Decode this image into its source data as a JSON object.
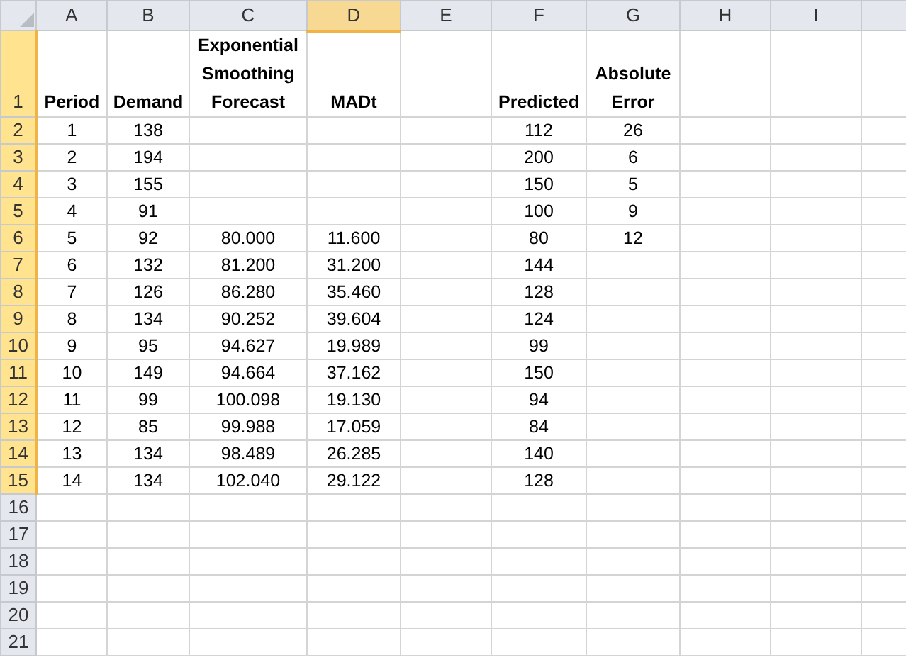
{
  "columns": [
    {
      "letter": "A",
      "selected": false
    },
    {
      "letter": "B",
      "selected": false
    },
    {
      "letter": "C",
      "selected": false
    },
    {
      "letter": "D",
      "selected": true
    },
    {
      "letter": "E",
      "selected": false
    },
    {
      "letter": "F",
      "selected": false
    },
    {
      "letter": "G",
      "selected": false
    },
    {
      "letter": "H",
      "selected": false
    },
    {
      "letter": "I",
      "selected": false
    }
  ],
  "rows": [
    {
      "number": "1",
      "selected": true,
      "kind": "header",
      "cells": [
        "Period",
        "Demand",
        "Exponential Smoothing Forecast",
        "MADt",
        null,
        "Predicted",
        "Absolute Error"
      ]
    },
    {
      "number": "2",
      "selected": true,
      "kind": "data",
      "cells": [
        "1",
        "138",
        null,
        null,
        null,
        "112",
        "26"
      ]
    },
    {
      "number": "3",
      "selected": true,
      "kind": "data",
      "cells": [
        "2",
        "194",
        null,
        null,
        null,
        "200",
        "6"
      ]
    },
    {
      "number": "4",
      "selected": true,
      "kind": "data",
      "cells": [
        "3",
        "155",
        null,
        null,
        null,
        "150",
        "5"
      ]
    },
    {
      "number": "5",
      "selected": true,
      "kind": "data",
      "cells": [
        "4",
        "91",
        null,
        null,
        null,
        "100",
        "9"
      ]
    },
    {
      "number": "6",
      "selected": true,
      "kind": "data",
      "cells": [
        "5",
        "92",
        "80.000",
        "11.600",
        null,
        "80",
        "12"
      ]
    },
    {
      "number": "7",
      "selected": true,
      "kind": "data",
      "cells": [
        "6",
        "132",
        "81.200",
        "31.200",
        null,
        "144"
      ]
    },
    {
      "number": "8",
      "selected": true,
      "kind": "data",
      "cells": [
        "7",
        "126",
        "86.280",
        "35.460",
        null,
        "128"
      ]
    },
    {
      "number": "9",
      "selected": true,
      "kind": "data",
      "cells": [
        "8",
        "134",
        "90.252",
        "39.604",
        null,
        "124"
      ]
    },
    {
      "number": "10",
      "selected": true,
      "kind": "data",
      "cells": [
        "9",
        "95",
        "94.627",
        "19.989",
        null,
        "99"
      ]
    },
    {
      "number": "11",
      "selected": true,
      "kind": "data",
      "cells": [
        "10",
        "149",
        "94.664",
        "37.162",
        null,
        "150"
      ]
    },
    {
      "number": "12",
      "selected": true,
      "kind": "data",
      "cells": [
        "11",
        "99",
        "100.098",
        "19.130",
        null,
        "94"
      ]
    },
    {
      "number": "13",
      "selected": true,
      "kind": "data",
      "cells": [
        "12",
        "85",
        "99.988",
        "17.059",
        null,
        "84"
      ]
    },
    {
      "number": "14",
      "selected": true,
      "kind": "data",
      "cells": [
        "13",
        "134",
        "98.489",
        "26.285",
        null,
        "140"
      ]
    },
    {
      "number": "15",
      "selected": true,
      "kind": "data",
      "cells": [
        "14",
        "134",
        "102.040",
        "29.122",
        null,
        "128"
      ]
    },
    {
      "number": "16",
      "selected": false,
      "kind": "data",
      "cells": []
    },
    {
      "number": "17",
      "selected": false,
      "kind": "data",
      "cells": []
    },
    {
      "number": "18",
      "selected": false,
      "kind": "data",
      "cells": []
    },
    {
      "number": "19",
      "selected": false,
      "kind": "data",
      "cells": []
    },
    {
      "number": "20",
      "selected": false,
      "kind": "data",
      "cells": []
    },
    {
      "number": "21",
      "selected": false,
      "kind": "data",
      "cells": []
    }
  ]
}
